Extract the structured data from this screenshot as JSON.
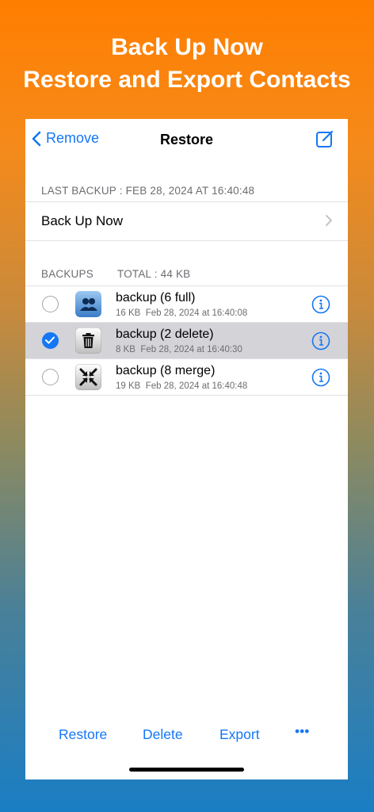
{
  "headline": {
    "line1": "Back Up Now",
    "line2": "Restore and Export Contacts"
  },
  "nav": {
    "back_label": "Remove",
    "title": "Restore"
  },
  "last_backup": "LAST BACKUP : FEB 28, 2024 AT 16:40:48",
  "backup_now_label": "Back Up Now",
  "backups_header": "BACKUPS",
  "total_header": "TOTAL : 44 KB",
  "backups": [
    {
      "title": "backup (6 full)",
      "size": "16 KB",
      "date": "Feb 28, 2024 at 16:40:08",
      "icon": "contacts-icon",
      "selected": false
    },
    {
      "title": "backup (2 delete)",
      "size": "8 KB",
      "date": "Feb 28, 2024 at 16:40:30",
      "icon": "trash-icon",
      "selected": true
    },
    {
      "title": "backup (8 merge)",
      "size": "19 KB",
      "date": "Feb 28, 2024 at 16:40:48",
      "icon": "merge-icon",
      "selected": false
    }
  ],
  "toolbar": {
    "restore": "Restore",
    "delete": "Delete",
    "export": "Export",
    "more": "•••"
  },
  "colors": {
    "accent": "#1577f5",
    "selected_row": "#d3d3d8",
    "gradient_top": "#ff7e00",
    "gradient_bottom": "#1a7ec4"
  }
}
